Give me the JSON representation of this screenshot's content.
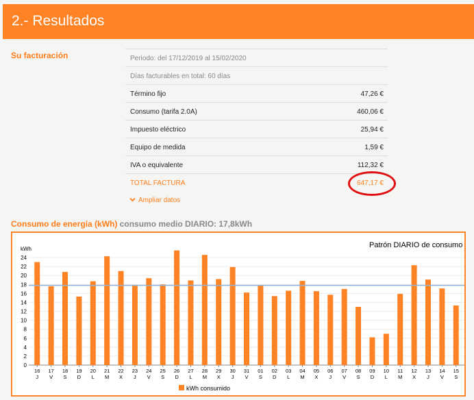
{
  "header": {
    "title": "2.- Resultados"
  },
  "billing": {
    "label": "Su facturación",
    "period": "Periodo: del 17/12/2019 al 15/02/2020",
    "days": "Días facturables en total: 60 días",
    "lines": [
      {
        "label": "Término fijo",
        "value": "47,26 €"
      },
      {
        "label": "Consumo (tarifa 2.0A)",
        "value": "460,06 €"
      },
      {
        "label": "Impuesto eléctrico",
        "value": "25,94 €"
      },
      {
        "label": "Equipo de medida",
        "value": "1,59 €"
      },
      {
        "label": "IVA o equivalente",
        "value": "112,32 €"
      }
    ],
    "total": {
      "label": "TOTAL FACTURA",
      "value": "647,17 €"
    },
    "expand": "Ampliar datos"
  },
  "energy": {
    "title": "Consumo de energía (kWh)",
    "subtitle": "consumo medio DIARIO: 17,8kWh"
  },
  "colors": {
    "accent": "#ff8324",
    "highlight": "#e01010",
    "avg_line": "#8fb4d9"
  },
  "chart_data": {
    "type": "bar",
    "title": "Patrón DIARIO de consumo",
    "ylabel": "kWh",
    "ylim": [
      0,
      26
    ],
    "yticks": [
      0,
      2,
      4,
      6,
      8,
      10,
      12,
      14,
      16,
      18,
      20,
      22,
      24
    ],
    "average": 17.8,
    "categories": [
      "16",
      "17",
      "18",
      "19",
      "20",
      "21",
      "22",
      "23",
      "24",
      "25",
      "26",
      "27",
      "28",
      "29",
      "30",
      "31",
      "01",
      "02",
      "03",
      "04",
      "05",
      "06",
      "07",
      "08",
      "09",
      "10",
      "11",
      "12",
      "13",
      "14",
      "15"
    ],
    "weekdays": [
      "J",
      "V",
      "S",
      "D",
      "L",
      "M",
      "X",
      "J",
      "V",
      "S",
      "D",
      "L",
      "M",
      "X",
      "J",
      "V",
      "S",
      "D",
      "L",
      "M",
      "X",
      "J",
      "V",
      "S",
      "D",
      "L",
      "M",
      "X",
      "J",
      "V",
      "S"
    ],
    "series": [
      {
        "name": "kWh consumido",
        "values": [
          23.0,
          17.6,
          20.8,
          15.3,
          18.7,
          24.3,
          21.0,
          17.9,
          19.4,
          18.0,
          25.6,
          18.9,
          24.6,
          19.2,
          21.9,
          16.2,
          17.7,
          15.4,
          16.6,
          18.8,
          16.5,
          15.7,
          17.0,
          13.0,
          6.2,
          7.0,
          15.9,
          22.3,
          19.1,
          17.1,
          13.3
        ]
      }
    ],
    "legend": "bottom"
  }
}
